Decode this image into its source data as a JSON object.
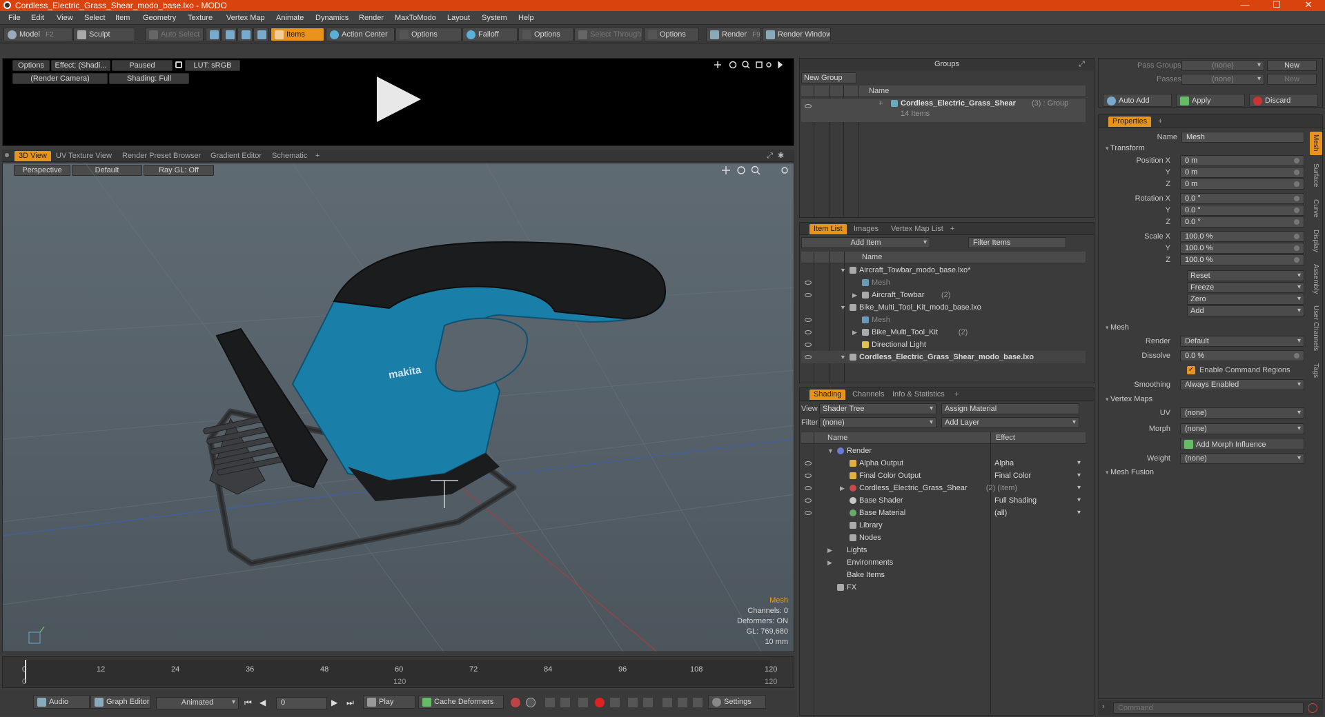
{
  "window": {
    "title": "Cordless_Electric_Grass_Shear_modo_base.lxo - MODO"
  },
  "menu": [
    "File",
    "Edit",
    "View",
    "Select",
    "Item",
    "Geometry",
    "Texture",
    "Vertex Map",
    "Animate",
    "Dynamics",
    "Render",
    "MaxToModo",
    "Layout",
    "System",
    "Help"
  ],
  "toolbar": {
    "model": "Model",
    "model_key": "F2",
    "sculpt": "Sculpt",
    "auto_select": "Auto Select",
    "items": "Items",
    "action_center": "Action Center",
    "options1": "Options",
    "falloff": "Falloff",
    "options2": "Options",
    "select_through": "Select Through",
    "options3": "Options",
    "render": "Render",
    "render_key": "F9",
    "render_window": "Render Window"
  },
  "preview": {
    "options": "Options",
    "effect": "Effect: (Shadi...",
    "paused": "Paused",
    "lut": "LUT: sRGB",
    "camera": "(Render Camera)",
    "shading": "Shading: Full"
  },
  "viewport": {
    "tabs": [
      "3D View",
      "UV Texture View",
      "Render Preset Browser",
      "Gradient Editor",
      "Schematic"
    ],
    "perspective": "Perspective",
    "default": "Default",
    "raygl": "Ray GL: Off",
    "brand_text": "makita",
    "info": {
      "type": "Mesh",
      "channels": "Channels: 0",
      "deformers": "Deformers: ON",
      "gl": "GL: 769,680",
      "scale": "10 mm"
    }
  },
  "timeline": {
    "ticks": [
      "0",
      "12",
      "24",
      "36",
      "48",
      "60",
      "72",
      "84",
      "96",
      "108",
      "120"
    ],
    "start": "0",
    "mid": "120",
    "end": "120"
  },
  "bottombar": {
    "audio": "Audio",
    "graph_editor": "Graph Editor",
    "animated": "Animated",
    "frame": "0",
    "play": "Play",
    "cache": "Cache Deformers",
    "settings": "Settings"
  },
  "groups": {
    "title": "Groups",
    "new_group": "New Group",
    "col_name": "Name",
    "item_name": "Cordless_Electric_Grass_Shear",
    "item_suffix": "(3) : Group",
    "item_count": "14 Items"
  },
  "itemlist": {
    "tabs": [
      "Item List",
      "Images",
      "Vertex Map List"
    ],
    "add_item": "Add Item",
    "filter": "Filter Items",
    "col_name": "Name",
    "rows": [
      {
        "label": "Aircraft_Towbar_modo_base.lxo*",
        "indent": 0,
        "kind": "scene",
        "bold": false,
        "dim": false,
        "suffix": ""
      },
      {
        "label": "Mesh",
        "indent": 1,
        "kind": "mesh",
        "bold": false,
        "dim": true,
        "suffix": ""
      },
      {
        "label": "Aircraft_Towbar",
        "indent": 1,
        "kind": "group",
        "bold": false,
        "dim": false,
        "suffix": "(2)"
      },
      {
        "label": "Bike_Multi_Tool_Kit_modo_base.lxo",
        "indent": 0,
        "kind": "scene",
        "bold": false,
        "dim": false,
        "suffix": ""
      },
      {
        "label": "Mesh",
        "indent": 1,
        "kind": "mesh",
        "bold": false,
        "dim": true,
        "suffix": ""
      },
      {
        "label": "Bike_Multi_Tool_Kit",
        "indent": 1,
        "kind": "group",
        "bold": false,
        "dim": false,
        "suffix": "(2)"
      },
      {
        "label": "Directional Light",
        "indent": 1,
        "kind": "light",
        "bold": false,
        "dim": false,
        "suffix": ""
      },
      {
        "label": "Cordless_Electric_Grass_Shear_modo_base.lxo",
        "indent": 0,
        "kind": "scene",
        "bold": true,
        "dim": false,
        "suffix": ""
      }
    ]
  },
  "shading": {
    "tabs": [
      "Shading",
      "Channels",
      "Info & Statistics"
    ],
    "view_label": "View",
    "view_value": "Shader Tree",
    "assign_material": "Assign Material",
    "filter_label": "Filter",
    "filter_value": "(none)",
    "add_layer": "Add Layer",
    "col_name": "Name",
    "col_effect": "Effect",
    "rows": [
      {
        "label": "Render",
        "effect": "",
        "indent": 0
      },
      {
        "label": "Alpha Output",
        "effect": "Alpha",
        "indent": 1
      },
      {
        "label": "Final Color Output",
        "effect": "Final Color",
        "indent": 1
      },
      {
        "label": "Cordless_Electric_Grass_Shear",
        "suffix": "(2) (Item)",
        "effect": "",
        "indent": 1
      },
      {
        "label": "Base Shader",
        "effect": "Full Shading",
        "indent": 1
      },
      {
        "label": "Base Material",
        "effect": "(all)",
        "indent": 1
      },
      {
        "label": "Library",
        "effect": "",
        "indent": 1
      },
      {
        "label": "Nodes",
        "effect": "",
        "indent": 1
      },
      {
        "label": "Lights",
        "effect": "",
        "indent": 0
      },
      {
        "label": "Environments",
        "effect": "",
        "indent": 0
      },
      {
        "label": "Bake Items",
        "effect": "",
        "indent": 0
      },
      {
        "label": "FX",
        "effect": "",
        "indent": 0
      }
    ]
  },
  "passes": {
    "pass_groups": "Pass Groups",
    "pass_groups_val": "(none)",
    "new1": "New",
    "passes": "Passes",
    "passes_val": "(none)",
    "new2": "New",
    "auto_add": "Auto Add",
    "apply": "Apply",
    "discard": "Discard"
  },
  "properties": {
    "tab": "Properties",
    "name_label": "Name",
    "name_value": "Mesh",
    "transform": "Transform",
    "position_label": "Position X",
    "rotation_label": "Rotation X",
    "scale_label": "Scale X",
    "axis_y": "Y",
    "axis_z": "Z",
    "pos": [
      "0 m",
      "0 m",
      "0 m"
    ],
    "rot": [
      "0.0 °",
      "0.0 °",
      "0.0 °"
    ],
    "scl": [
      "100.0 %",
      "100.0 %",
      "100.0 %"
    ],
    "reset": "Reset",
    "freeze": "Freeze",
    "zero": "Zero",
    "add": "Add",
    "mesh_section": "Mesh",
    "render_label": "Render",
    "render_value": "Default",
    "dissolve_label": "Dissolve",
    "dissolve_value": "0.0 %",
    "enable_cmd": "Enable Command Regions",
    "smoothing_label": "Smoothing",
    "smoothing_value": "Always Enabled",
    "vertex_maps": "Vertex Maps",
    "uv_label": "UV",
    "uv_value": "(none)",
    "morph_label": "Morph",
    "morph_value": "(none)",
    "add_morph": "Add Morph Influence",
    "weight_label": "Weight",
    "weight_value": "(none)",
    "mesh_fusion": "Mesh Fusion",
    "side_tabs": [
      "Mesh",
      "Surface",
      "Curve",
      "Display",
      "Assembly",
      "User Channels",
      "Tags"
    ]
  },
  "command": {
    "placeholder": "Command"
  }
}
